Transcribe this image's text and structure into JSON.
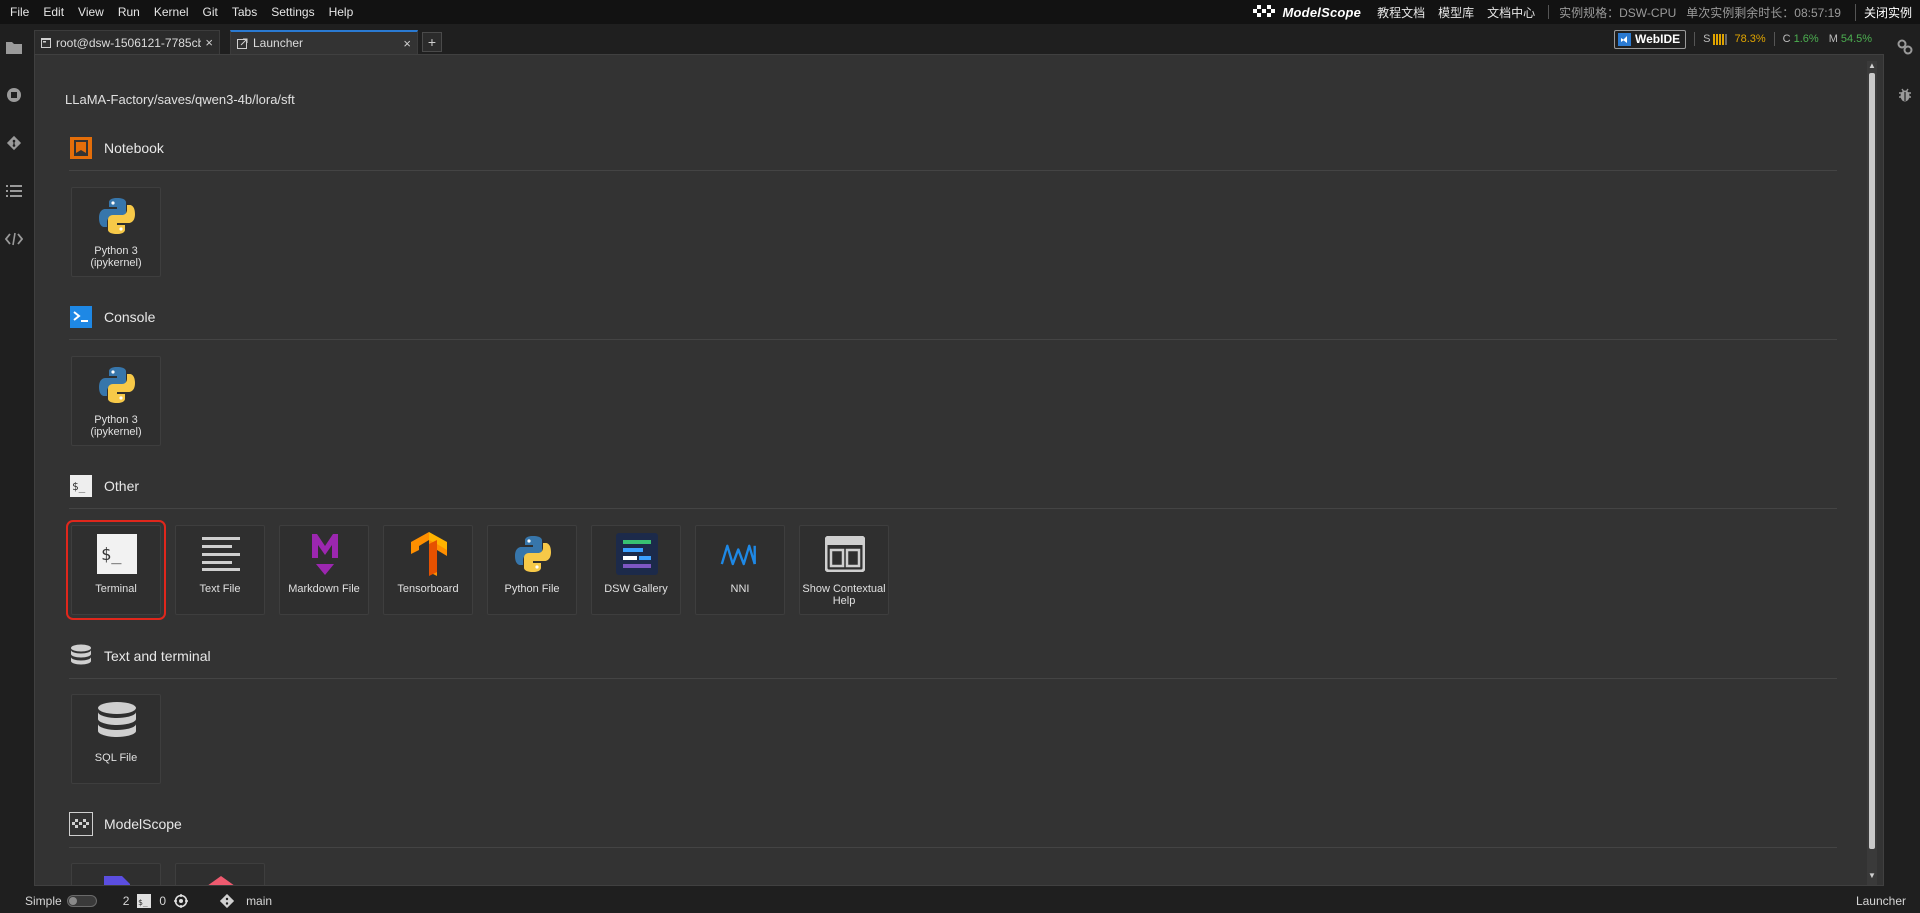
{
  "menu": [
    "File",
    "Edit",
    "View",
    "Run",
    "Kernel",
    "Git",
    "Tabs",
    "Settings",
    "Help"
  ],
  "header": {
    "brand": "ModelScope",
    "links": [
      "教程文档",
      "模型库",
      "文档中心"
    ],
    "instance_spec": "实例规格：DSW-CPU",
    "remaining_time": "单次实例剩余时长：08:57:19",
    "close_instance": "关闭实例"
  },
  "tabs": [
    {
      "label": "root@dsw-1506121-7785cb",
      "close": "×"
    },
    {
      "label": "Launcher",
      "close": "×"
    }
  ],
  "add_tab": "+",
  "resources": {
    "webide_label": "WebIDE",
    "storage_letter": "S",
    "storage_value": "78.3%",
    "cpu_letter": "C",
    "cpu_value": "1.6%",
    "mem_letter": "M",
    "mem_value": "54.5%",
    "storage_color": "#e0a400",
    "cpu_color": "#4caf50",
    "mem_color": "#4caf50"
  },
  "launcher": {
    "path": "LLaMA-Factory/saves/qwen3-4b/lora/sft",
    "sections": {
      "notebook": {
        "title": "Notebook",
        "cards": [
          {
            "label": "Python 3 (ipykernel)"
          }
        ]
      },
      "console": {
        "title": "Console",
        "cards": [
          {
            "label": "Python 3 (ipykernel)"
          }
        ]
      },
      "other": {
        "title": "Other",
        "cards": [
          {
            "label": "Terminal"
          },
          {
            "label": "Text File"
          },
          {
            "label": "Markdown File"
          },
          {
            "label": "Tensorboard"
          },
          {
            "label": "Python File"
          },
          {
            "label": "DSW Gallery"
          },
          {
            "label": "NNI"
          },
          {
            "label": "Show Contextual Help"
          }
        ]
      },
      "text_terminal": {
        "title": "Text and terminal",
        "cards": [
          {
            "label": "SQL File"
          }
        ]
      },
      "modelscope": {
        "title": "ModelScope"
      }
    }
  },
  "statusbar": {
    "mode": "Simple",
    "terminals": "2",
    "kernels": "0",
    "branch": "main",
    "current": "Launcher"
  }
}
